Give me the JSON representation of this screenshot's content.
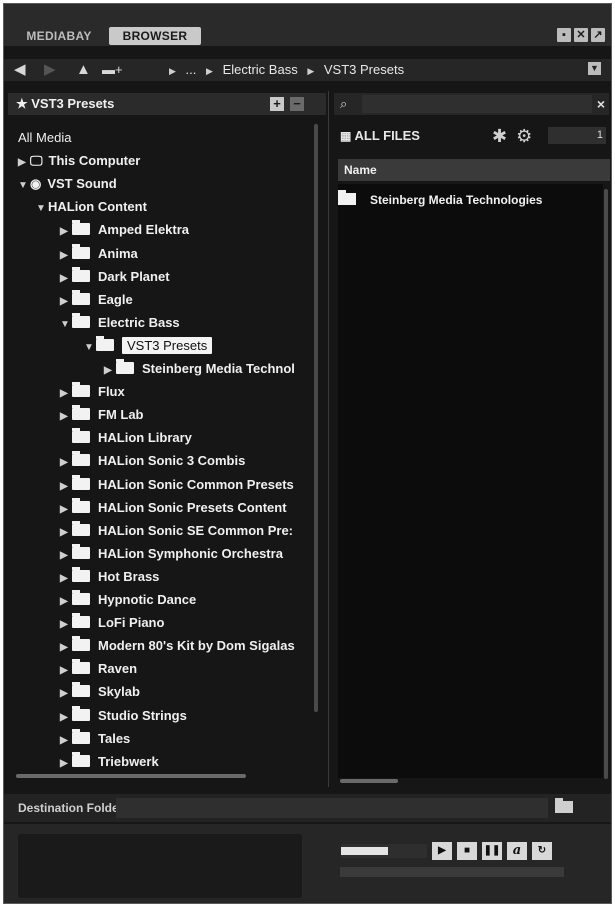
{
  "tabs": {
    "mediabay": "MEDIABAY",
    "browser": "BROWSER"
  },
  "window_icons": [
    "save-icon",
    "close-icon",
    "expand-icon"
  ],
  "nav": {
    "back": "🡐",
    "forward": "🡒",
    "up": "🡑",
    "crumbs": [
      "...",
      "Electric Bass",
      "VST3 Presets"
    ]
  },
  "left_panel": {
    "title": "★ VST3 Presets",
    "add": "+",
    "remove": "−",
    "tree": [
      {
        "label": "All Media",
        "indent": 0,
        "arrow": "",
        "icon": "none"
      },
      {
        "label": "This Computer",
        "indent": 0,
        "arrow": "▶",
        "icon": "monitor"
      },
      {
        "label": "VST Sound",
        "indent": 0,
        "arrow": "▼",
        "icon": "disc"
      },
      {
        "label": "HALion Content",
        "indent": 1,
        "arrow": "▼",
        "icon": "none"
      },
      {
        "label": "Amped Elektra",
        "indent": 2,
        "arrow": "▶",
        "icon": "folder"
      },
      {
        "label": "Anima",
        "indent": 2,
        "arrow": "▶",
        "icon": "folder"
      },
      {
        "label": "Dark Planet",
        "indent": 2,
        "arrow": "▶",
        "icon": "folder"
      },
      {
        "label": "Eagle",
        "indent": 2,
        "arrow": "▶",
        "icon": "folder"
      },
      {
        "label": "Electric Bass",
        "indent": 2,
        "arrow": "▼",
        "icon": "folder"
      },
      {
        "label": "VST3 Presets",
        "indent": 3,
        "arrow": "▼",
        "icon": "folder",
        "selected": true
      },
      {
        "label": "Steinberg Media Technol",
        "indent": 4,
        "arrow": "▶",
        "icon": "folder"
      },
      {
        "label": "Flux",
        "indent": 2,
        "arrow": "▶",
        "icon": "folder"
      },
      {
        "label": "FM Lab",
        "indent": 2,
        "arrow": "▶",
        "icon": "folder"
      },
      {
        "label": "HALion Library",
        "indent": 2,
        "arrow": "",
        "icon": "folder"
      },
      {
        "label": "HALion Sonic 3 Combis",
        "indent": 2,
        "arrow": "▶",
        "icon": "folder"
      },
      {
        "label": "HALion Sonic Common Presets",
        "indent": 2,
        "arrow": "▶",
        "icon": "folder"
      },
      {
        "label": "HALion Sonic Presets Content",
        "indent": 2,
        "arrow": "▶",
        "icon": "folder"
      },
      {
        "label": "HALion Sonic SE Common Pre:",
        "indent": 2,
        "arrow": "▶",
        "icon": "folder"
      },
      {
        "label": "HALion Symphonic Orchestra",
        "indent": 2,
        "arrow": "▶",
        "icon": "folder"
      },
      {
        "label": "Hot Brass",
        "indent": 2,
        "arrow": "▶",
        "icon": "folder"
      },
      {
        "label": "Hypnotic Dance",
        "indent": 2,
        "arrow": "▶",
        "icon": "folder"
      },
      {
        "label": "LoFi Piano",
        "indent": 2,
        "arrow": "▶",
        "icon": "folder"
      },
      {
        "label": "Modern 80's Kit by Dom Sigalas",
        "indent": 2,
        "arrow": "▶",
        "icon": "folder"
      },
      {
        "label": "Raven",
        "indent": 2,
        "arrow": "▶",
        "icon": "folder"
      },
      {
        "label": "Skylab",
        "indent": 2,
        "arrow": "▶",
        "icon": "folder"
      },
      {
        "label": "Studio Strings",
        "indent": 2,
        "arrow": "▶",
        "icon": "folder"
      },
      {
        "label": "Tales",
        "indent": 2,
        "arrow": "▶",
        "icon": "folder"
      },
      {
        "label": "Triebwerk",
        "indent": 2,
        "arrow": "▶",
        "icon": "folder"
      }
    ]
  },
  "right_panel": {
    "search_clear": "×",
    "filter_label": "ALL FILES",
    "count": "1",
    "column_name": "Name",
    "rows": [
      "Steinberg Media Technologies"
    ]
  },
  "destination": {
    "label": "Destination Folder"
  },
  "preview": {
    "level": 0.55,
    "buttons": [
      "play-icon",
      "stop-icon",
      "pause-icon",
      "auto-play-icon",
      "loop-icon"
    ]
  }
}
